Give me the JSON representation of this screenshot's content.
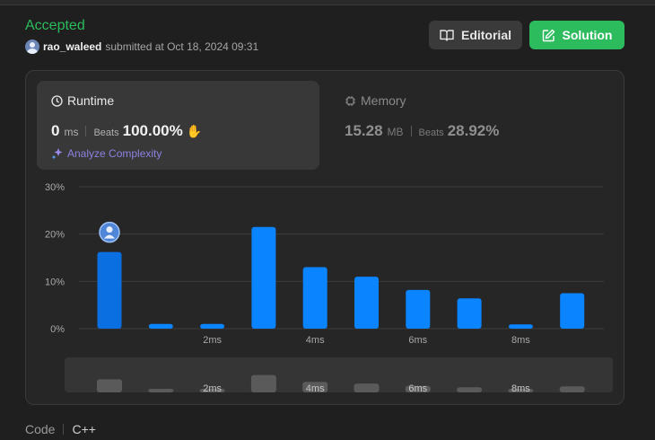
{
  "submission": {
    "status": "Accepted",
    "username": "rao_waleed",
    "submitted_text": "submitted at Oct 18, 2024 09:31"
  },
  "actions": {
    "editorial_label": "Editorial",
    "solution_label": "Solution"
  },
  "runtime": {
    "title": "Runtime",
    "value": "0",
    "unit": "ms",
    "beats_label": "Beats",
    "beats_value": "100.00%",
    "icon": "clock-icon",
    "analyze_label": "Analyze Complexity"
  },
  "memory": {
    "title": "Memory",
    "value": "15.28",
    "unit": "MB",
    "beats_label": "Beats",
    "beats_value": "28.92%",
    "icon": "chip-icon"
  },
  "colors": {
    "accent_green": "#2cbb5d",
    "bar_blue": "#0a84ff",
    "bar_blue_selected": "#0a6fe0",
    "minimap_bar": "#5a5a5a"
  },
  "chart_data": {
    "type": "bar",
    "x": [
      0,
      1,
      2,
      3,
      4,
      5,
      6,
      7,
      8,
      9
    ],
    "x_unit": "ms",
    "values": [
      16.2,
      1.0,
      1.0,
      21.5,
      13.0,
      11.0,
      8.2,
      6.4,
      0.9,
      7.5
    ],
    "xticks": [
      {
        "value": 2,
        "label": "2ms"
      },
      {
        "value": 4,
        "label": "4ms"
      },
      {
        "value": 6,
        "label": "6ms"
      },
      {
        "value": 8,
        "label": "8ms"
      }
    ],
    "yticks": [
      {
        "value": 0,
        "label": "0%"
      },
      {
        "value": 10,
        "label": "10%"
      },
      {
        "value": 20,
        "label": "20%"
      },
      {
        "value": 30,
        "label": "30%"
      }
    ],
    "ylim": [
      0,
      30
    ],
    "highlight_index": 0,
    "grid": true
  },
  "footer": {
    "code_label": "Code",
    "language": "C++"
  }
}
